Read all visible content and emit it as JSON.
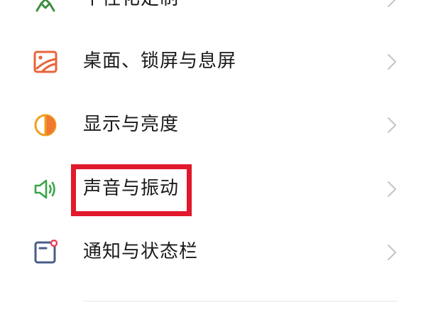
{
  "settings": {
    "items": [
      {
        "label": "个性化定制",
        "icon": "personalize-icon",
        "icon_color": "#3f8e3f"
      },
      {
        "label": "桌面、锁屏与息屏",
        "icon": "wallpaper-icon",
        "icon_color": "#e8643b"
      },
      {
        "label": "显示与亮度",
        "icon": "display-brightness-icon",
        "icon_color": "#f0a020"
      },
      {
        "label": "声音与振动",
        "icon": "speaker-icon",
        "icon_color": "#38a648"
      },
      {
        "label": "通知与状态栏",
        "icon": "notification-icon",
        "icon_color": "#4a5d88",
        "badge_color": "#e8405a"
      }
    ]
  },
  "highlight": {
    "target": "声音与振动",
    "color": "#e0192c"
  }
}
